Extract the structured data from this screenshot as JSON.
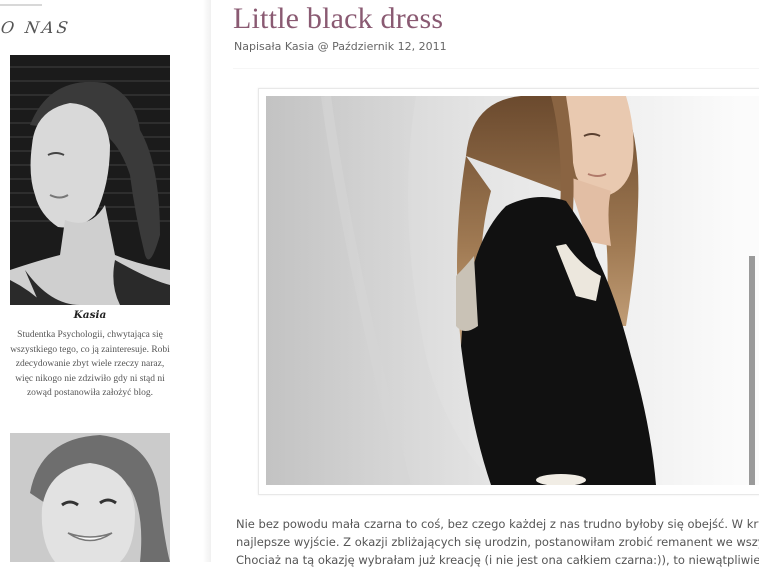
{
  "sidebar": {
    "section_title": "O NAS",
    "authors": [
      {
        "name": "Kasia",
        "bio": "Studentka Psychologii, chwytająca się wszystkiego tego, co ją zainteresuje. Robi zdecydowanie zbyt wiele rzeczy naraz, więc nikogo nie zdziwiło gdy ni stąd ni zowąd postanowiła założyć blog."
      }
    ]
  },
  "post": {
    "title": "Little black dress",
    "meta": "Napisała Kasia @ Październik 12, 2011",
    "paragraph_lines": [
      "Nie bez powodu mała czarna to coś, bez czego każdej z nas trudno byłoby się obejść. W kryzy",
      "najlepsze wyjście. Z okazji zbliżających się urodzin, postanowiłam zrobić remanent we wszystk",
      "Chociaż na tą okazję wybrałam już kreację (i nie jest ona całkiem czarna:)), to niewątpliwie n"
    ]
  }
}
